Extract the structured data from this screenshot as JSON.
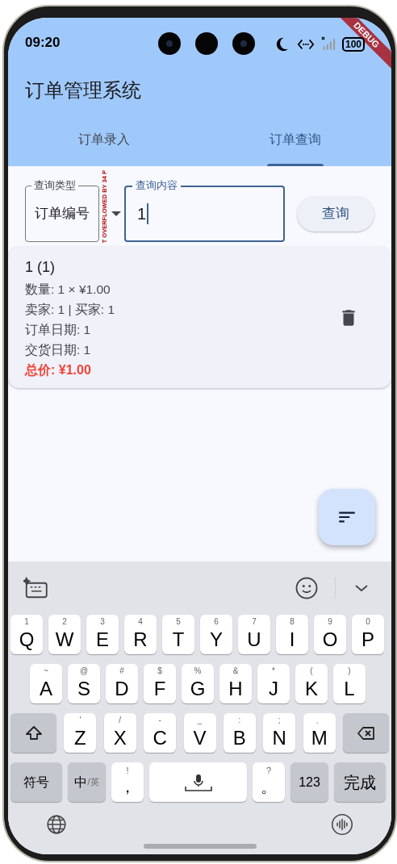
{
  "status_bar": {
    "time": "09:20",
    "battery": "100"
  },
  "debug_banner": "DEBUG",
  "app_bar": {
    "title": "订单管理系统"
  },
  "tabs": [
    {
      "label": "订单录入",
      "selected": false
    },
    {
      "label": "订单查询",
      "selected": true
    }
  ],
  "query": {
    "type_label": "查询类型",
    "type_value": "订单编号",
    "overflow_warning": "T OVERFLOWED BY 34 P",
    "content_label": "查询内容",
    "content_value": "1",
    "button": "查询"
  },
  "orders": [
    {
      "title": "1 (1)",
      "lines": [
        "数量: 1 × ¥1.00",
        "卖家: 1 | 买家: 1",
        "订单日期: 1",
        "交货日期: 1"
      ],
      "total": "总价: ¥1.00"
    }
  ],
  "keyboard": {
    "rows": [
      [
        {
          "kind": "letter",
          "label": "Q",
          "hint": "1"
        },
        {
          "kind": "letter",
          "label": "W",
          "hint": "2"
        },
        {
          "kind": "letter",
          "label": "E",
          "hint": "3"
        },
        {
          "kind": "letter",
          "label": "R",
          "hint": "4"
        },
        {
          "kind": "letter",
          "label": "T",
          "hint": "5"
        },
        {
          "kind": "letter",
          "label": "Y",
          "hint": "6"
        },
        {
          "kind": "letter",
          "label": "U",
          "hint": "7"
        },
        {
          "kind": "letter",
          "label": "I",
          "hint": "8"
        },
        {
          "kind": "letter",
          "label": "O",
          "hint": "9"
        },
        {
          "kind": "letter",
          "label": "P",
          "hint": "0"
        }
      ],
      [
        {
          "kind": "letter",
          "label": "A",
          "hint": "~"
        },
        {
          "kind": "letter",
          "label": "S",
          "hint": "@"
        },
        {
          "kind": "letter",
          "label": "D",
          "hint": "#"
        },
        {
          "kind": "letter",
          "label": "F",
          "hint": "$"
        },
        {
          "kind": "letter",
          "label": "G",
          "hint": "%"
        },
        {
          "kind": "letter",
          "label": "H",
          "hint": "&"
        },
        {
          "kind": "letter",
          "label": "J",
          "hint": "*"
        },
        {
          "kind": "letter",
          "label": "K",
          "hint": "("
        },
        {
          "kind": "letter",
          "label": "L",
          "hint": ")"
        }
      ],
      [
        {
          "kind": "shift"
        },
        {
          "kind": "letter",
          "label": "Z",
          "hint": "'"
        },
        {
          "kind": "letter",
          "label": "X",
          "hint": "/"
        },
        {
          "kind": "letter",
          "label": "C",
          "hint": "-"
        },
        {
          "kind": "letter",
          "label": "V",
          "hint": "_"
        },
        {
          "kind": "letter",
          "label": "B",
          "hint": ":"
        },
        {
          "kind": "letter",
          "label": "N",
          "hint": ";"
        },
        {
          "kind": "letter",
          "label": "M",
          "hint": "、"
        },
        {
          "kind": "backspace"
        }
      ]
    ],
    "bottom_row": [
      {
        "kind": "function",
        "label": "符号"
      },
      {
        "kind": "lang",
        "label": "中",
        "sub": "/英"
      },
      {
        "kind": "punct",
        "label": "，",
        "hint": "!"
      },
      {
        "kind": "space"
      },
      {
        "kind": "punct",
        "label": "。",
        "hint": "?"
      },
      {
        "kind": "function",
        "label": "123"
      },
      {
        "kind": "function",
        "label": "完成"
      }
    ]
  }
}
